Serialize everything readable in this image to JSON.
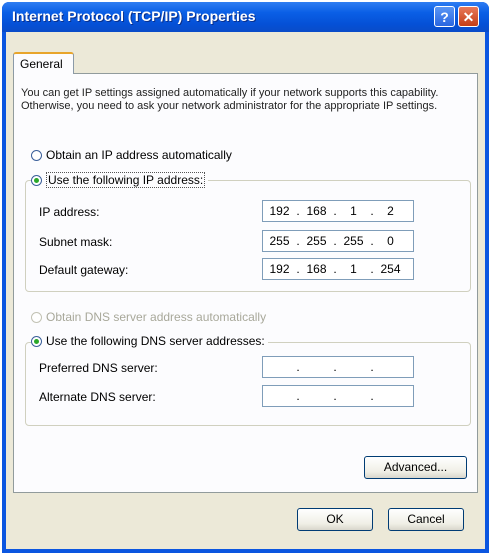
{
  "window": {
    "title": "Internet Protocol (TCP/IP) Properties",
    "help_label": "?",
    "close_label": "✕"
  },
  "tabs": [
    {
      "label": "General",
      "selected": true
    }
  ],
  "general": {
    "description": "You can get IP settings assigned automatically if your network supports this capability. Otherwise, you need to ask your network administrator for the appropriate IP settings.",
    "ip_options": {
      "auto_label": "Obtain an IP address automatically",
      "manual_label": "Use the following IP address:",
      "selected": "manual"
    },
    "ip_fields": {
      "ip_address": {
        "label": "IP address:",
        "octets": [
          "192",
          "168",
          "1",
          "2"
        ]
      },
      "subnet_mask": {
        "label": "Subnet mask:",
        "octets": [
          "255",
          "255",
          "255",
          "0"
        ]
      },
      "default_gateway": {
        "label": "Default gateway:",
        "octets": [
          "192",
          "168",
          "1",
          "254"
        ]
      }
    },
    "dns_options": {
      "auto_label": "Obtain DNS server address automatically",
      "manual_label": "Use the following DNS server addresses:",
      "selected": "manual",
      "auto_enabled": false
    },
    "dns_fields": {
      "preferred": {
        "label": "Preferred DNS server:",
        "octets": [
          "",
          "",
          "",
          ""
        ]
      },
      "alternate": {
        "label": "Alternate DNS server:",
        "octets": [
          "",
          "",
          "",
          ""
        ]
      }
    },
    "ip_separator": ".",
    "advanced_label": "Advanced..."
  },
  "footer": {
    "ok_label": "OK",
    "cancel_label": "Cancel"
  }
}
